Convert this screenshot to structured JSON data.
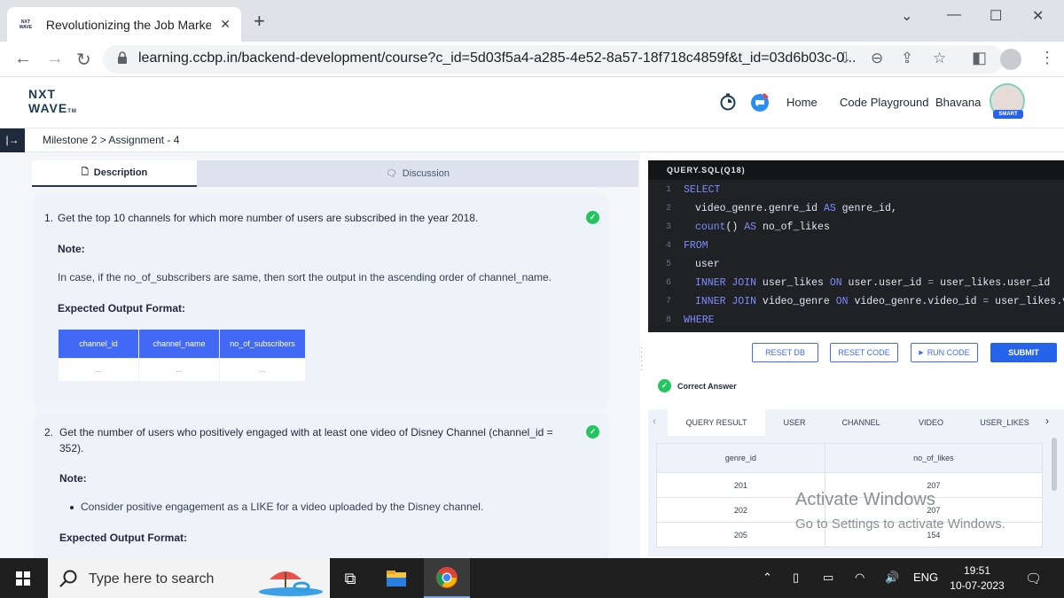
{
  "browser": {
    "tab_title": "Revolutionizing the Job Market |",
    "favicon_text": "NXT WAVE",
    "url": "learning.ccbp.in/backend-development/course?c_id=5d03f5a4-a285-4e52-8a57-18f718c4859f&t_id=03d6b03c-0..."
  },
  "header": {
    "logo_line1": "NXT",
    "logo_line2": "WAVE",
    "logo_tm": "TM",
    "nav": [
      "Home",
      "Code Playground",
      "Bhavana"
    ],
    "badge": "SMART"
  },
  "breadcrumb": "Milestone 2 > Assignment - 4",
  "left_tabs": {
    "description": "Description",
    "discussion": "Discussion"
  },
  "q1": {
    "number": "1.",
    "text": "Get the top 10 channels for which more number of users are subscribed in the year 2018.",
    "note_label": "Note:",
    "note_text": "In case, if the no_of_subscribers are same, then sort the output in the ascending order of channel_name.",
    "expected_label": "Expected Output Format:",
    "columns": [
      "channel_id",
      "channel_name",
      "no_of_subscribers"
    ],
    "row": [
      "...",
      "...",
      "..."
    ]
  },
  "q2": {
    "number": "2.",
    "text_line1": "Get the number of users who positively engaged with at least one video of Disney Channel (channel_id =",
    "text_line2": "352).",
    "note_label": "Note:",
    "bullet": "Consider positive engagement as a LIKE for a video uploaded by the Disney channel.",
    "expected_label": "Expected Output Format:"
  },
  "editor": {
    "title": "QUERY.SQL(Q18)",
    "line_numbers": [
      "1",
      "2",
      "3",
      "4",
      "5",
      "6",
      "7",
      "8"
    ],
    "lines": [
      [
        "SELECT"
      ],
      [
        "video_genre.genre_id ",
        "AS",
        " genre_id,"
      ],
      [
        "count",
        "() ",
        "AS",
        " no_of_likes"
      ],
      [
        "FROM"
      ],
      [
        "user"
      ],
      [
        "INNER JOIN",
        " user_likes ",
        "ON",
        " user.user_id ",
        "=",
        " user_likes.user_id"
      ],
      [
        "INNER JOIN",
        " video_genre ",
        "ON",
        " video_genre.video_id ",
        "=",
        " user_likes.vi"
      ],
      [
        "WHERE"
      ]
    ]
  },
  "buttons": {
    "reset_db": "RESET DB",
    "reset_code": "RESET CODE",
    "run_code": "RUN CODE",
    "submit": "SUBMIT"
  },
  "status": "Correct Answer",
  "result_tabs": [
    "QUERY RESULT",
    "USER",
    "CHANNEL",
    "VIDEO",
    "USER_LIKES"
  ],
  "result": {
    "columns": [
      "genre_id",
      "no_of_likes"
    ],
    "rows": [
      [
        "201",
        "207"
      ],
      [
        "202",
        "207"
      ],
      [
        "205",
        "154"
      ]
    ]
  },
  "watermark": {
    "line1": "Activate Windows",
    "line2": "Go to Settings to activate Windows."
  },
  "taskbar": {
    "search_placeholder": "Type here to search",
    "language": "ENG",
    "time": "19:51",
    "date": "10-07-2023"
  }
}
